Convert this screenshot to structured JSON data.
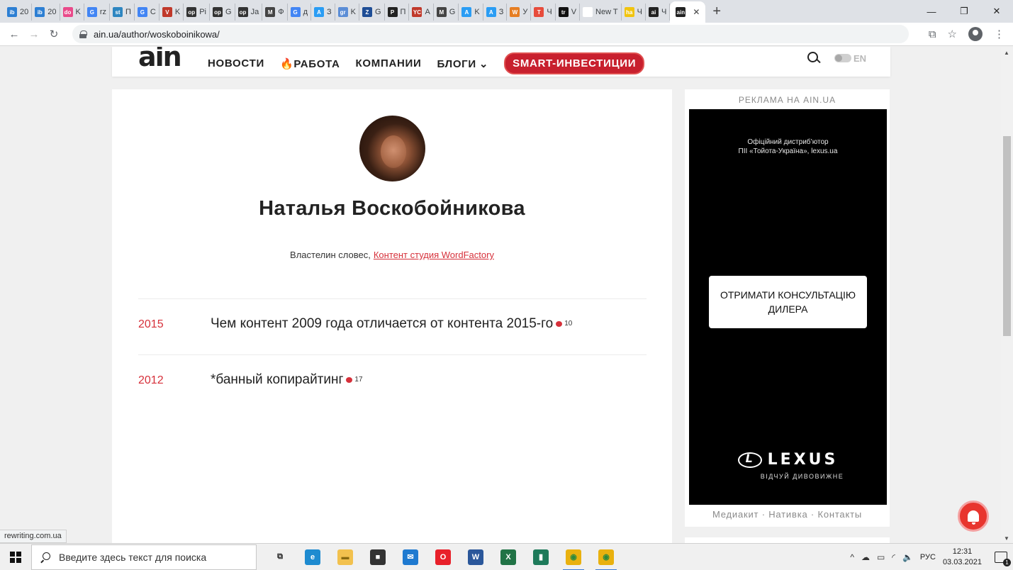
{
  "browser": {
    "tabs": [
      {
        "label": "20",
        "favicon": "ibb",
        "color": "#2d7fd3"
      },
      {
        "label": "20",
        "favicon": "ibb",
        "color": "#2d7fd3"
      },
      {
        "label": "K",
        "favicon": "dots",
        "color": "#e94a8a"
      },
      {
        "label": "rz",
        "favicon": "G",
        "color": "#4285f4"
      },
      {
        "label": "П",
        "favicon": "star",
        "color": "#2e86c1"
      },
      {
        "label": "C",
        "favicon": "G",
        "color": "#4285f4"
      },
      {
        "label": "K",
        "favicon": "V",
        "color": "#c0392b"
      },
      {
        "label": "Pi",
        "favicon": "openai",
        "color": "#333333"
      },
      {
        "label": "G",
        "favicon": "openai",
        "color": "#333333"
      },
      {
        "label": "Ja",
        "favicon": "openai",
        "color": "#333333"
      },
      {
        "label": "Ф",
        "favicon": "M",
        "color": "#444444"
      },
      {
        "label": "д",
        "favicon": "G",
        "color": "#4285f4"
      },
      {
        "label": "З",
        "favicon": "A",
        "color": "#2a9df4"
      },
      {
        "label": "K",
        "favicon": "grid",
        "color": "#5b8dd6"
      },
      {
        "label": "G",
        "favicon": "Z",
        "color": "#1f4e96"
      },
      {
        "label": "П",
        "favicon": "P",
        "color": "#222222"
      },
      {
        "label": "A",
        "favicon": "YC",
        "color": "#c0392b"
      },
      {
        "label": "G",
        "favicon": "M",
        "color": "#444444"
      },
      {
        "label": "K",
        "favicon": "A",
        "color": "#2a9df4"
      },
      {
        "label": "З",
        "favicon": "A",
        "color": "#2a9df4"
      },
      {
        "label": "У",
        "favicon": "W",
        "color": "#e67e22"
      },
      {
        "label": "Ч",
        "favicon": "T",
        "color": "#e74c3c"
      },
      {
        "label": "V",
        "favicon": "tri",
        "color": "#111111"
      },
      {
        "label": "New T",
        "favicon": "",
        "color": "#ffffff"
      },
      {
        "label": "Ч",
        "favicon": "hand",
        "color": "#f1c40f"
      },
      {
        "label": "Ч",
        "favicon": "ain",
        "color": "#222222"
      }
    ],
    "active_tab": {
      "favicon": "ain",
      "close": "✕"
    },
    "new_tab": "+",
    "window_controls": {
      "minimize": "—",
      "restore": "❐",
      "close": "✕"
    },
    "nav": {
      "back": "←",
      "forward": "→",
      "reload": "↻"
    },
    "url": "ain.ua/author/woskoboinikowa/",
    "addr_icons": {
      "translate": "⧉",
      "bookmark": "☆",
      "menu": "⋮"
    },
    "status_url": "rewriting.com.ua"
  },
  "site": {
    "logo": "ain",
    "nav": [
      {
        "label": "НОВОСТИ"
      },
      {
        "label": "РАБОТА",
        "icon": "fire-icon"
      },
      {
        "label": "КОМПАНИИ"
      },
      {
        "label": "БЛОГИ",
        "chevron": "⌄"
      },
      {
        "label": "SMART-ИНВЕСТИЦИИ"
      }
    ],
    "lang_toggle": "EN",
    "fire": "🔥"
  },
  "author": {
    "name": "Наталья Воскобойникова",
    "bio_text": "Властелин словес,",
    "bio_link": "Контент студия WordFactory"
  },
  "posts": [
    {
      "year": "2015",
      "title": "Чем контент 2009 года отличается от контента 2015-го",
      "comments": "10"
    },
    {
      "year": "2012",
      "title": "*банный копирайтинг",
      "comments": "17"
    }
  ],
  "sidebar": {
    "ad_label": "РЕКЛАМА НА AIN.UA",
    "ad": {
      "distributor_line1": "Офіційний дистриб’ютор",
      "distributor_line2": "ПІІ «Тойота-Україна», lexus.ua",
      "cta": "ОТРИМАТИ КОНСУЛЬТАЦІЮ ДИЛЕРА",
      "brand": "LEXUS",
      "tagline": "ВІДЧУЙ ДИВОВИЖНЕ"
    },
    "footer": "Медиакит · Нативка · Контакты"
  },
  "taskbar": {
    "search_placeholder": "Введите здесь текст для поиска",
    "apps": [
      {
        "name": "task-view",
        "glyph": "⧉",
        "color": "#f0f0f0",
        "fg": "#222"
      },
      {
        "name": "edge",
        "glyph": "e",
        "color": "#1e8bd0",
        "fg": "#fff"
      },
      {
        "name": "explorer",
        "glyph": "▬",
        "color": "#f2c14e",
        "fg": "#8a6a10"
      },
      {
        "name": "store",
        "glyph": "■",
        "color": "#333333",
        "fg": "#fff"
      },
      {
        "name": "mail",
        "glyph": "✉",
        "color": "#1f7ad0",
        "fg": "#fff"
      },
      {
        "name": "opera",
        "glyph": "O",
        "color": "#e8202a",
        "fg": "#fff"
      },
      {
        "name": "word",
        "glyph": "W",
        "color": "#2b579a",
        "fg": "#fff"
      },
      {
        "name": "excel",
        "glyph": "X",
        "color": "#217346",
        "fg": "#fff"
      },
      {
        "name": "app-green",
        "glyph": "▮",
        "color": "#1e7a5a",
        "fg": "#fff"
      },
      {
        "name": "chrome",
        "glyph": "◉",
        "color": "#e9b10f",
        "fg": "#2d8a3e"
      },
      {
        "name": "chrome-2",
        "glyph": "◉",
        "color": "#e9b10f",
        "fg": "#2d8a3e"
      }
    ],
    "tray": {
      "chevron": "^",
      "lang": "РУС",
      "time": "12:31",
      "date": "03.03.2021"
    }
  }
}
